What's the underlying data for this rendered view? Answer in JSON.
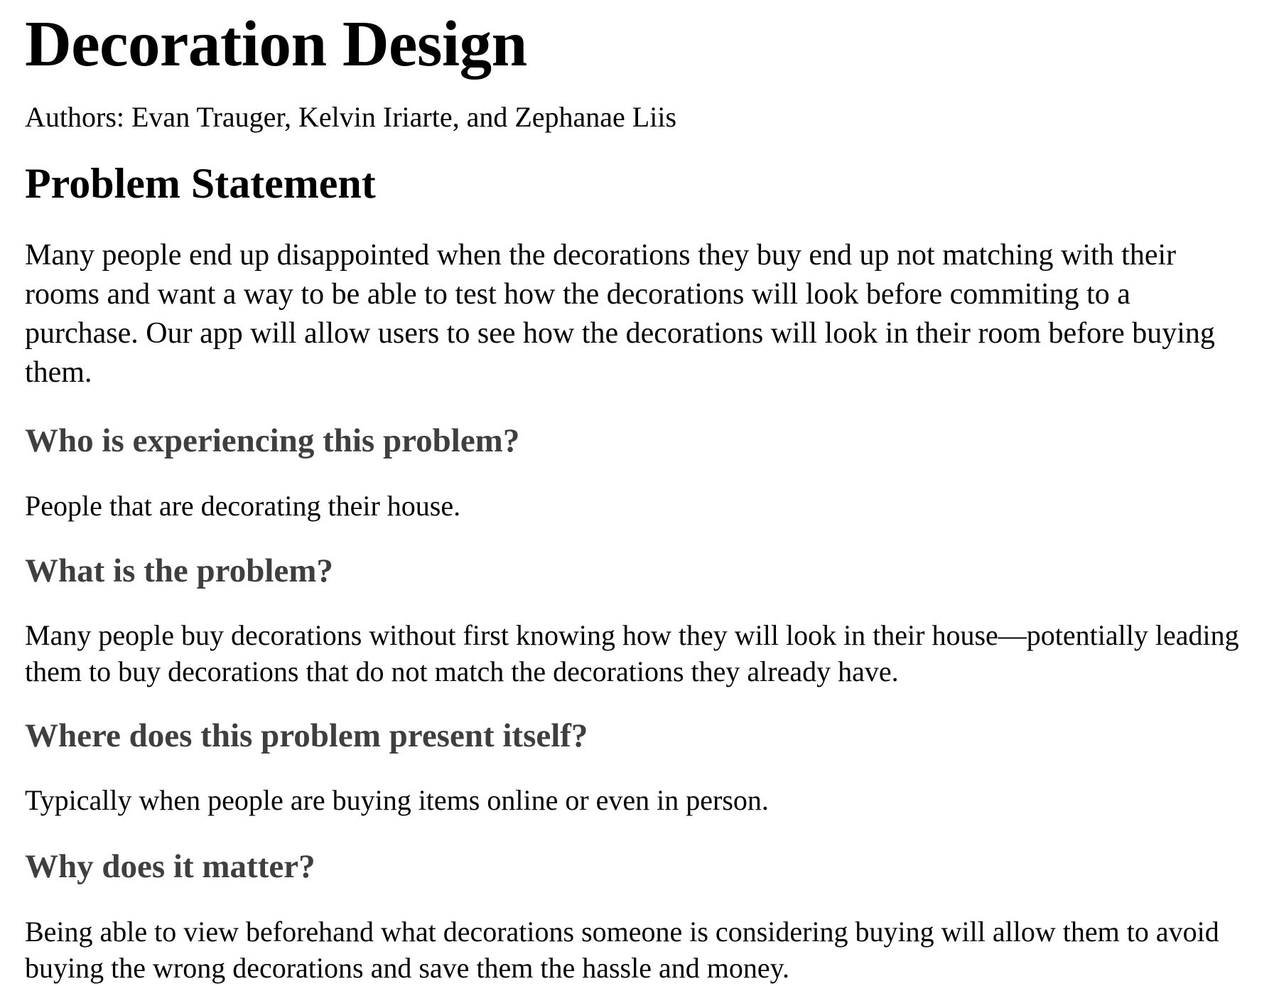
{
  "document": {
    "title": "Decoration Design",
    "authors": "Authors: Evan Trauger, Kelvin Iriarte, and Zephanae Liis",
    "section_heading": "Problem Statement",
    "intro": "Many people end up disappointed when the decorations they buy end up not matching with their rooms and want a way to be able to test how the decorations will look before commiting to a purchase. Our app will allow users to see how the decorations will look in their room before buying them.",
    "questions": [
      {
        "heading": "Who is experiencing this problem?",
        "answer": "People that are decorating their house."
      },
      {
        "heading": "What is the problem?",
        "answer": "Many people buy decorations without first knowing how they will look in their house—potentially leading them to buy decorations that do not match the decorations they already have."
      },
      {
        "heading": "Where does this problem present itself?",
        "answer": "Typically when people are buying items online or even in person."
      },
      {
        "heading": "Why does it matter?",
        "answer": "Being able to view beforehand what decorations someone is considering buying will allow them to avoid buying the wrong decorations and save them the hassle and money."
      }
    ]
  }
}
